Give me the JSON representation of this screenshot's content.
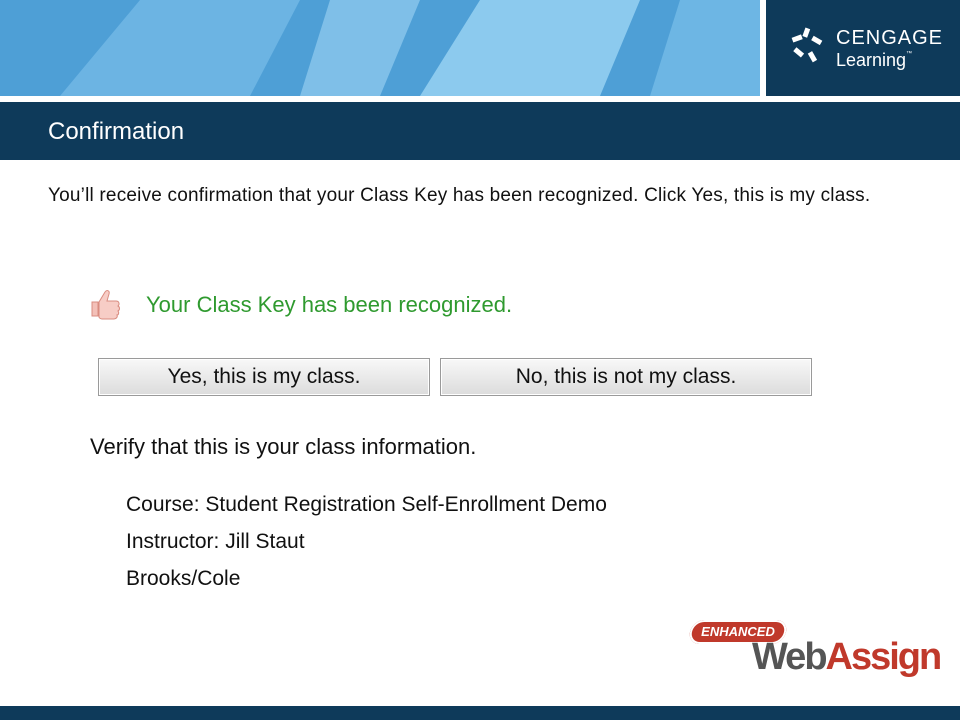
{
  "header": {
    "logo": {
      "line1": "CENGAGE",
      "line2": "Learning",
      "trademark": "™",
      "icon": "cengage-logo-icon"
    }
  },
  "slide": {
    "title": "Confirmation",
    "instruction": "You’ll receive confirmation that your Class Key has been recognized. Click Yes, this is my class."
  },
  "screenshot": {
    "status_icon": "thumbs-up-icon",
    "status_text": "Your Class Key has been recognized.",
    "yes_button": "Yes, this is my class.",
    "no_button": "No, this is not my class.",
    "verify_text": "Verify that this is your class information.",
    "course": "Course: Student Registration Self-Enrollment Demo",
    "instructor": "Instructor: Jill Staut",
    "publisher": "Brooks/Cole"
  },
  "footer_logo": {
    "badge": "ENHANCED",
    "web": "Web",
    "assign": "Assign"
  },
  "colors": {
    "navy": "#0e3a5a",
    "banner_blue": "#5aa9dd",
    "status_green": "#2f9a2f",
    "ewa_red": "#c0392b"
  }
}
